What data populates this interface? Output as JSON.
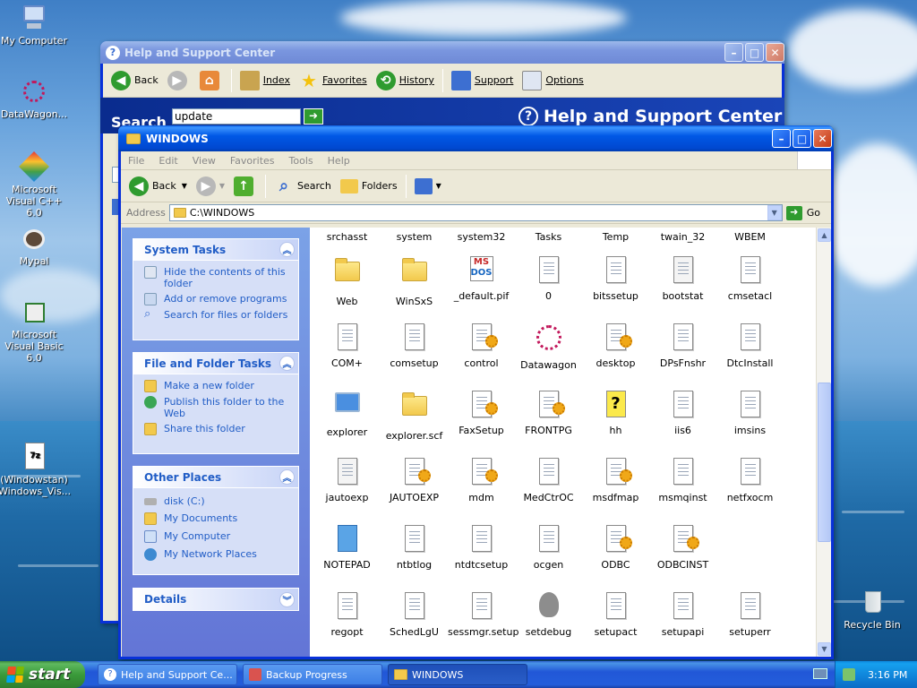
{
  "desktop": {
    "icons": [
      {
        "label": "My Computer",
        "icon": "computer-icon"
      },
      {
        "label": "DataWagon...",
        "icon": "datawagon-icon"
      },
      {
        "label": "Microsoft Visual C++ 6.0",
        "icon": "visual-cpp-icon"
      },
      {
        "label": "Mypal",
        "icon": "mypal-icon"
      },
      {
        "label": "Microsoft Visual Basic 6.0",
        "icon": "visual-basic-icon"
      },
      {
        "label": "(Windowstan) Windows_Vis...",
        "icon": "7z-archive-icon"
      },
      {
        "label": "Recycle Bin",
        "icon": "recycle-bin-icon"
      }
    ]
  },
  "help_window": {
    "title": "Help and Support Center",
    "toolbar": {
      "back": "Back",
      "index": "Index",
      "favorites": "Favorites",
      "history": "History",
      "support": "Support",
      "options": "Options"
    },
    "search_label": "Search",
    "search_value": "update",
    "banner": "Help and Support Center"
  },
  "explorer": {
    "title": "WINDOWS",
    "menu": [
      "File",
      "Edit",
      "View",
      "Favorites",
      "Tools",
      "Help"
    ],
    "toolbar": {
      "back": "Back",
      "search": "Search",
      "folders": "Folders"
    },
    "address_label": "Address",
    "address_value": "C:\\WINDOWS",
    "go": "Go",
    "system_tasks": {
      "title": "System Tasks",
      "items": [
        "Hide the contents of this folder",
        "Add or remove programs",
        "Search for files or folders"
      ]
    },
    "file_tasks": {
      "title": "File and Folder Tasks",
      "items": [
        "Make a new folder",
        "Publish this folder to the Web",
        "Share this folder"
      ]
    },
    "other_places": {
      "title": "Other Places",
      "items": [
        "disk (C:)",
        "My Documents",
        "My Computer",
        "My Network Places"
      ]
    },
    "details": {
      "title": "Details"
    },
    "files": [
      [
        "srchasst",
        "system",
        "system32",
        "Tasks",
        "Temp",
        "twain_32",
        "WBEM"
      ],
      [
        "Web",
        "WinSxS",
        "_default.pif",
        "0",
        "bitssetup",
        "bootstat",
        "cmsetacl"
      ],
      [
        "COM+",
        "comsetup",
        "control",
        "Datawagon",
        "desktop",
        "DPsFnshr",
        "DtcInstall"
      ],
      [
        "explorer",
        "explorer.scf",
        "FaxSetup",
        "FRONTPG",
        "hh",
        "iis6",
        "imsins"
      ],
      [
        "jautoexp",
        "JAUTOEXP",
        "mdm",
        "MedCtrOC",
        "msdfmap",
        "msmqinst",
        "netfxocm"
      ],
      [
        "NOTEPAD",
        "ntbtlog",
        "ntdtcsetup",
        "ocgen",
        "ODBC",
        "ODBCINST"
      ],
      [
        "regopt",
        "SchedLgU",
        "sessmgr.setup",
        "setdebug",
        "setupact",
        "setupapi",
        "setuperr"
      ]
    ]
  },
  "taskbar": {
    "start": "start",
    "tasks": [
      "Help and Support Ce...",
      "Backup Progress",
      "WINDOWS"
    ],
    "clock": "3:16 PM"
  }
}
